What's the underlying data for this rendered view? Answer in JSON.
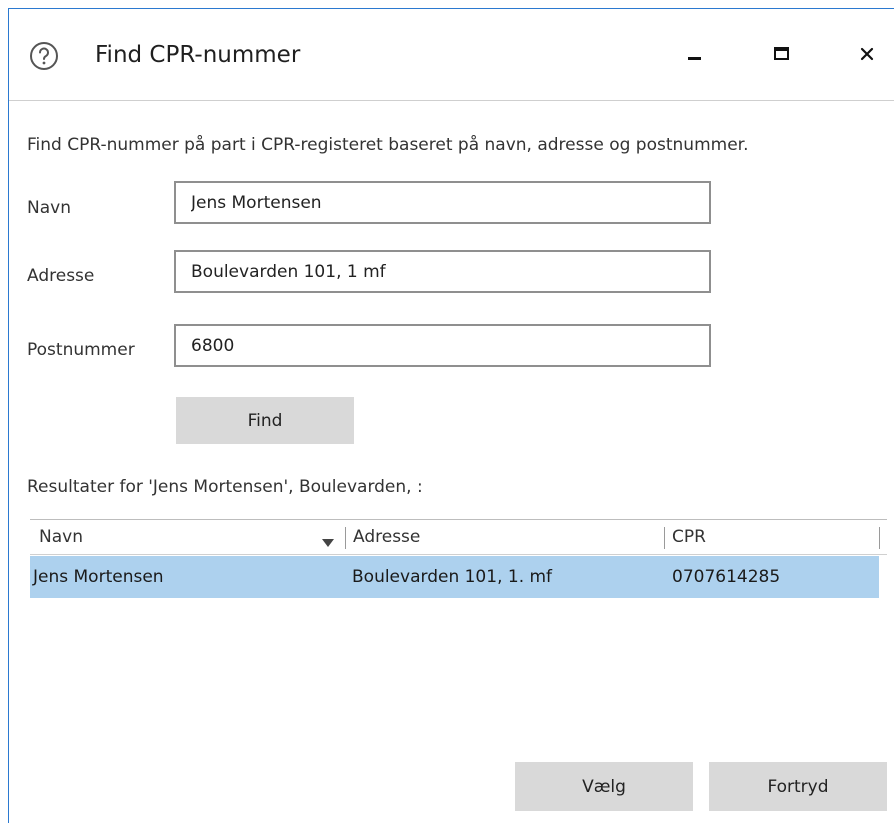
{
  "window": {
    "title": "Find CPR-nummer",
    "icons": {
      "help": "help-circle-icon",
      "minimize": "minimize-icon",
      "maximize": "maximize-icon",
      "close": "close-icon"
    },
    "accent_color": "#2b79d0"
  },
  "form": {
    "description": "Find CPR-nummer på part i CPR-registeret baseret på navn, adresse og postnummer.",
    "name_label": "Navn",
    "name_value": "Jens Mortensen",
    "address_label": "Adresse",
    "address_value": "Boulevarden 101, 1 mf",
    "postcode_label": "Postnummer",
    "postcode_value": "6800",
    "find_label": "Find"
  },
  "results": {
    "summary": "Resultater for 'Jens Mortensen', Boulevarden, :",
    "columns": [
      "Navn",
      "Adresse",
      "CPR"
    ],
    "sort_icon": "sort-down-icon",
    "rows": [
      {
        "navn": "Jens Mortensen",
        "adresse": "Boulevarden 101, 1. mf",
        "cpr": "0707614285"
      }
    ],
    "selected_color": "#add1ee"
  },
  "footer": {
    "select_label": "Vælg",
    "cancel_label": "Fortryd"
  }
}
